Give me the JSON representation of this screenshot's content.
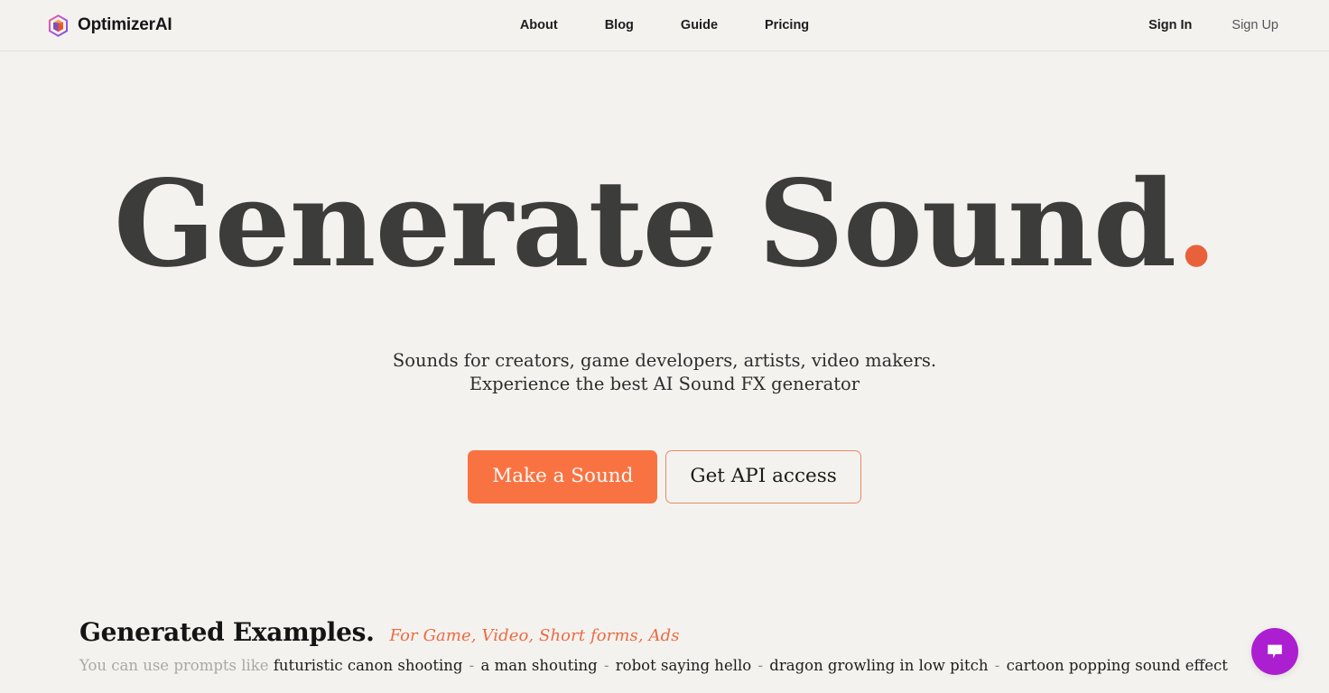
{
  "brand": {
    "name": "OptimizerAI",
    "logo_icon": "hexagon-cube-icon"
  },
  "header": {
    "nav": [
      {
        "label": "About"
      },
      {
        "label": "Blog"
      },
      {
        "label": "Guide"
      },
      {
        "label": "Pricing"
      }
    ],
    "sign_in_label": "Sign In",
    "sign_up_label": "Sign Up"
  },
  "hero": {
    "title_main": "Generate Sound",
    "title_dot": ".",
    "subtitle_line1": "Sounds for creators, game developers, artists, video makers.",
    "subtitle_line2": "Experience the best AI Sound FX generator",
    "primary_cta": "Make a Sound",
    "secondary_cta": "Get API access"
  },
  "examples": {
    "title": "Generated Examples.",
    "tags": "For  Game, Video, Short forms, Ads",
    "prompt_lead": "You can use prompts like",
    "prompt_sep": "-",
    "prompts": [
      "futuristic canon shooting",
      "a man shouting",
      "robot saying hello",
      "dragon growling in low pitch",
      "cartoon popping sound effect"
    ]
  },
  "chat": {
    "icon": "chat-bubble-icon",
    "color": "#ab1fd1"
  },
  "colors": {
    "background": "#f4f2ef",
    "accent_orange": "#f97342",
    "accent_dot": "#e8613a",
    "heading": "#3c3c3a",
    "header_border": "#e3e1dc"
  }
}
